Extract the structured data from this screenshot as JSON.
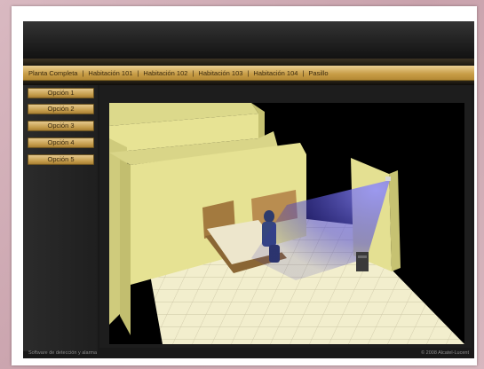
{
  "nav": {
    "tabs": [
      "Planta Completa",
      "Habitación 101",
      "Habitación 102",
      "Habitación 103",
      "Habitación 104",
      "Pasillo"
    ]
  },
  "sidebar": {
    "options": [
      "Opción 1",
      "Opción 2",
      "Opción 3",
      "Opción 4",
      "Opción 5"
    ]
  },
  "footer": {
    "left": "Software de detección y alarma",
    "right": "© 2008 Alcatel-Lucent"
  },
  "colors": {
    "gold_accent": "#c99f4b",
    "wall": "#e4e08f",
    "floor": "#f1edc9",
    "sensor_beam": "#5a55d8"
  }
}
